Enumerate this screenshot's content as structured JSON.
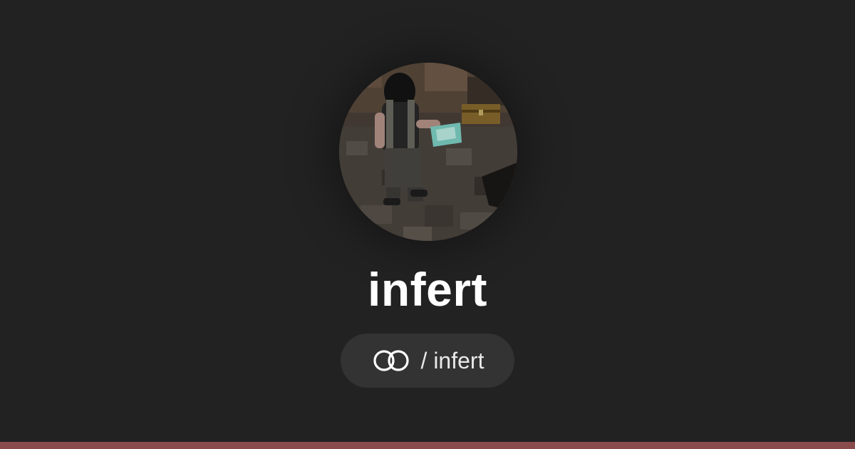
{
  "profile": {
    "name": "infert",
    "handle": "/ infert",
    "logo_icon": "linked-rings-icon",
    "avatar": "profile-photo"
  },
  "colors": {
    "background": "#222222",
    "pill_background": "#333333",
    "text": "#ffffff",
    "accent_bar": "#8a4b4d"
  }
}
